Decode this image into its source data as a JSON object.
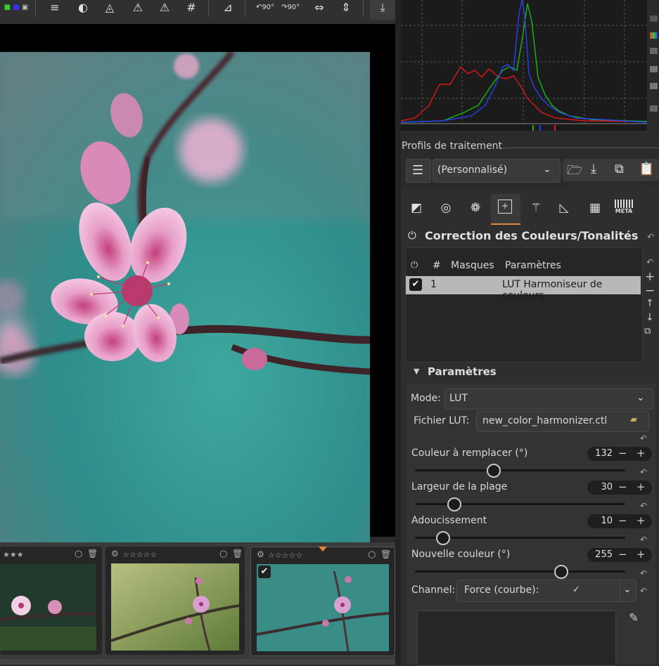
{
  "toolbar": {
    "icons": [
      "color-chip-icon",
      "list-plus-icon",
      "circle-half-icon",
      "triangle-circle-icon",
      "warning-icon",
      "warning-outline-icon",
      "grid-icon",
      "perspective-icon",
      "rotate-left-icon",
      "rotate-right-icon",
      "flip-horizontal-icon",
      "flip-vertical-icon",
      "pin-down-icon"
    ],
    "rotate_left_label": "90°",
    "rotate_right_label": "90°"
  },
  "processing_profiles": {
    "title": "Profils de traitement",
    "selected": "(Personnalisé)"
  },
  "tool_tabs": [
    "exposure-icon",
    "detail-icon",
    "color-icon",
    "local-adjustments-icon",
    "wand-icon",
    "transform-icon",
    "raw-icon",
    "meta-icon"
  ],
  "meta_label": "META",
  "panel": {
    "title": "Correction des Couleurs/Tonalités",
    "table_headers": {
      "hash": "#",
      "masks": "Masques",
      "params": "Paramètres"
    },
    "rows": [
      {
        "num": "1",
        "params": "LUT Harmoniseur de couleurs"
      }
    ],
    "params_section": "Paramètres",
    "mode_label": "Mode:",
    "mode_value": "LUT",
    "lut_label": "Fichier LUT:",
    "lut_value": "new_color_harmonizer.ctl",
    "sliders": [
      {
        "label": "Couleur à remplacer (°)",
        "value": "132",
        "fraction": 0.37
      },
      {
        "label": "Largeur de la plage",
        "value": "30",
        "fraction": 0.18
      },
      {
        "label": "Adoucissement",
        "value": "10",
        "fraction": 0.13
      },
      {
        "label": "Nouvelle couleur (°)",
        "value": "255",
        "fraction": 0.7
      }
    ],
    "channel_label": "Channel:",
    "channel_value": "Force (courbe):"
  },
  "colors": {
    "accent": "#e08a3c",
    "panel": "#2b2b2b",
    "teal": "#3aa39a",
    "blossom": "#e8a0c8"
  }
}
